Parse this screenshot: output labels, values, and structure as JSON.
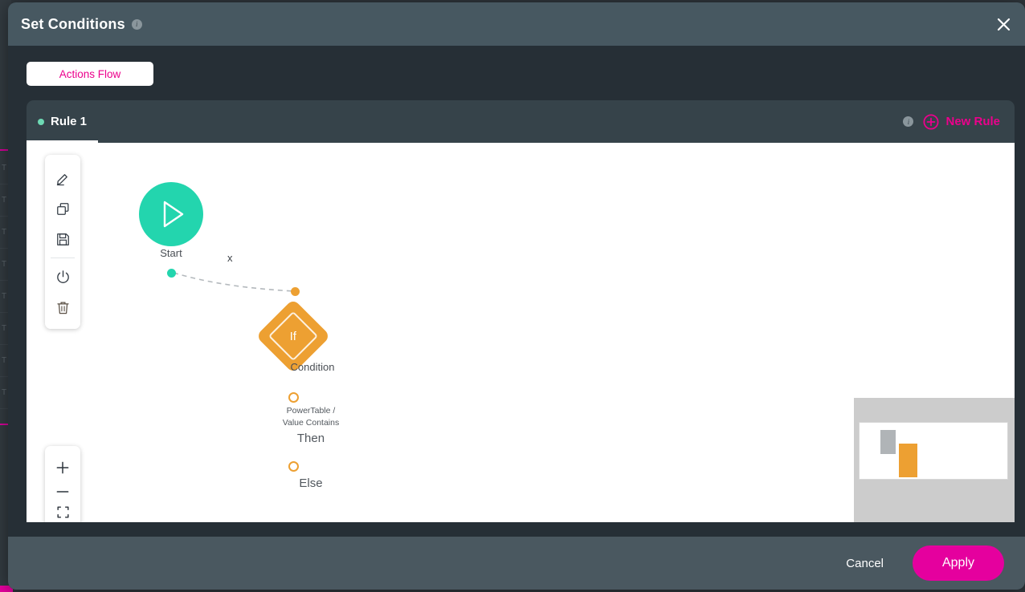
{
  "backdrop": {
    "rows": [
      "T",
      "T",
      "T",
      "T",
      "T",
      "T",
      "T",
      "T"
    ]
  },
  "header": {
    "title": "Set Conditions",
    "info_icon": "info-icon",
    "close_icon": "close-icon"
  },
  "flow_tab": {
    "label": "Actions Flow"
  },
  "rule_bar": {
    "tabs": [
      {
        "label": "Rule 1",
        "dot_color": "#6ed9b4",
        "active": true
      }
    ],
    "info_icon": "info-icon",
    "new_rule_label": "New Rule",
    "new_rule_icon": "plus-circle-icon"
  },
  "toolbar": {
    "items": [
      {
        "icon": "edit-pencil-icon",
        "name": "edit-tool"
      },
      {
        "icon": "copy-icon",
        "name": "copy-tool"
      },
      {
        "icon": "save-floppy-icon",
        "name": "save-tool"
      },
      {
        "icon": "power-icon",
        "name": "power-tool"
      },
      {
        "icon": "trash-icon",
        "name": "delete-tool"
      }
    ]
  },
  "zoom_controls": {
    "items": [
      {
        "icon": "plus-icon",
        "name": "zoom-in-button"
      },
      {
        "icon": "minus-icon",
        "name": "zoom-out-button"
      },
      {
        "icon": "fit-screen-icon",
        "name": "fit-to-screen-button"
      }
    ]
  },
  "canvas": {
    "nodes": [
      {
        "id": "start",
        "label": "Start",
        "shape": "circle",
        "color": "#23d5ae",
        "icon": "play-triangle-icon"
      },
      {
        "id": "condition",
        "label": "Condition",
        "shape": "diamond",
        "color": "#eda032",
        "text": "If"
      }
    ],
    "edges": [
      {
        "from": "start",
        "to": "condition",
        "style": "dashed",
        "marker": "x"
      }
    ],
    "branches": [
      {
        "id": "then",
        "caption": "PowerTable /\nValue Contains",
        "label": "Then"
      },
      {
        "id": "else",
        "caption": "",
        "label": "Else"
      }
    ]
  },
  "minimap": {
    "name": "canvas-minimap"
  },
  "footer": {
    "cancel_label": "Cancel",
    "apply_label": "Apply",
    "apply_color": "#e5009e"
  },
  "colors": {
    "header_bg": "#475861",
    "modal_bg": "#262f36",
    "tabbar_bg": "#36434a",
    "footer_bg": "#4a5860",
    "accent_pink": "#ec008c",
    "teal": "#23d5ae",
    "orange": "#eda032"
  }
}
